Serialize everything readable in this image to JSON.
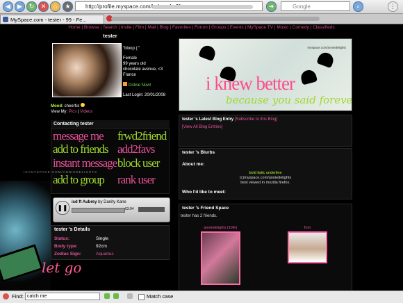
{
  "browser": {
    "url": "http://profile.myspace.com/index.cfm?fusea",
    "search_placeholder": "Google",
    "tab_title": "MySpace.com - tester - 99 - Fe..."
  },
  "topnav": [
    "Home",
    "Browse",
    "Search",
    "Invite",
    "Film",
    "Mail",
    "Blog",
    "Favorites",
    "Forum",
    "Groups",
    "Events",
    "MySpace TV",
    "Music",
    "Comedy",
    "Classifieds"
  ],
  "profile": {
    "name": "tester",
    "quote": "\"bloop (:\"",
    "gender": "Female",
    "age": "99 years old",
    "location_line1": "chocolate avenue, <3",
    "location_line2": "France",
    "online_label": "Online Now!",
    "last_login_label": "Last Login:",
    "last_login_value": "20/01/2008",
    "mood_label": "Mood:",
    "mood_value": "cheerful",
    "view_my_label": "View My:",
    "view_my_links": [
      "Pics",
      "Videos"
    ]
  },
  "contacting": {
    "title": "Contacting tester",
    "items": [
      "message me",
      "frwd2friend",
      "add to friends",
      "add2favs",
      "instant message",
      "block user",
      "add to group",
      "rank user"
    ],
    "overlay_text": "ICANYSPACE.COM/ANNIEDELIGHTS"
  },
  "player": {
    "song": "isd ft Aubrey",
    "by": "by Danity Kane",
    "time": "03:04"
  },
  "details": {
    "title": "tester 's Details",
    "rows": [
      {
        "label": "Status:",
        "value": "Single"
      },
      {
        "label": "Body type:",
        "value": "92cm"
      },
      {
        "label": "Zodiac Sign:",
        "value": "Aquarius"
      }
    ]
  },
  "overlay_bottom": "let go",
  "banner": {
    "credit": "myspace.com/anniedelights",
    "headline": "i knew better",
    "script": "because you said forever"
  },
  "blog": {
    "title": "tester 's Latest Blog Entry",
    "subscribe": "[Subscribe to this Blog]",
    "view_all": "[View All Blog Entries]"
  },
  "blurbs": {
    "title": "tester 's Blurbs",
    "about_me_label": "About me:",
    "about_lines": [
      "bold italic underline",
      "(c)myspace.com/anniedelights",
      "best viewed in mozilla firefox."
    ],
    "who_label": "Who I'd like to meet:"
  },
  "friends": {
    "title": "tester 's Friend Space",
    "count_line": "tester  has  2  friends.",
    "items": [
      {
        "name": "anniedelights [10fe]"
      },
      {
        "name": "Tom"
      }
    ]
  },
  "findbar": {
    "label": "Find:",
    "value": "catch me",
    "match_case": "Match case"
  }
}
